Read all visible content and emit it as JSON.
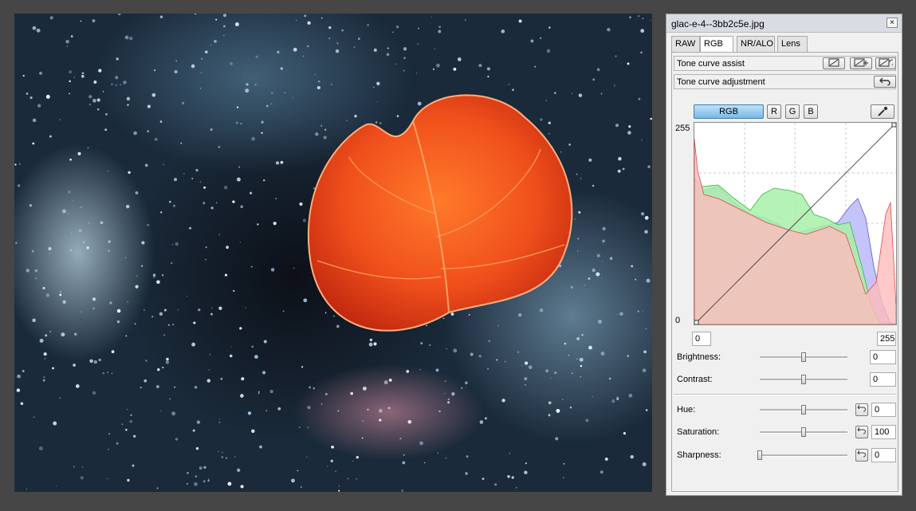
{
  "window": {
    "title": "glac-e-4--3bb2c5e.jpg",
    "close_label": "×"
  },
  "tabs": [
    {
      "label": "RAW",
      "active": false
    },
    {
      "label": "RGB",
      "active": true
    },
    {
      "label": "NR/ALO",
      "active": false
    },
    {
      "label": "Lens",
      "active": false
    }
  ],
  "tone_curve_assist": {
    "label": "Tone curve assist"
  },
  "tone_curve_adjustment": {
    "label": "Tone curve adjustment",
    "reset_icon": "undo-icon"
  },
  "channels": [
    {
      "label": "RGB",
      "active": true
    },
    {
      "label": "R",
      "active": false
    },
    {
      "label": "G",
      "active": false
    },
    {
      "label": "B",
      "active": false
    }
  ],
  "curve": {
    "y_max_label": "255",
    "y_min_label": "0",
    "input_min": "0",
    "input_max": "255"
  },
  "adjustments": {
    "brightness": {
      "label": "Brightness:",
      "value": "0",
      "level": 0.5
    },
    "contrast": {
      "label": "Contrast:",
      "value": "0",
      "level": 0.5
    },
    "hue": {
      "label": "Hue:",
      "value": "0",
      "level": 0.5
    },
    "saturation": {
      "label": "Saturation:",
      "value": "100",
      "level": 0.5
    },
    "sharpness": {
      "label": "Sharpness:",
      "value": "0",
      "level": 0.0
    }
  },
  "colors": {
    "accent_button": "#7ab8e6",
    "hist_red": "#ff8c8c",
    "hist_green": "#8cef8c",
    "hist_blue": "#9e9ef5"
  }
}
